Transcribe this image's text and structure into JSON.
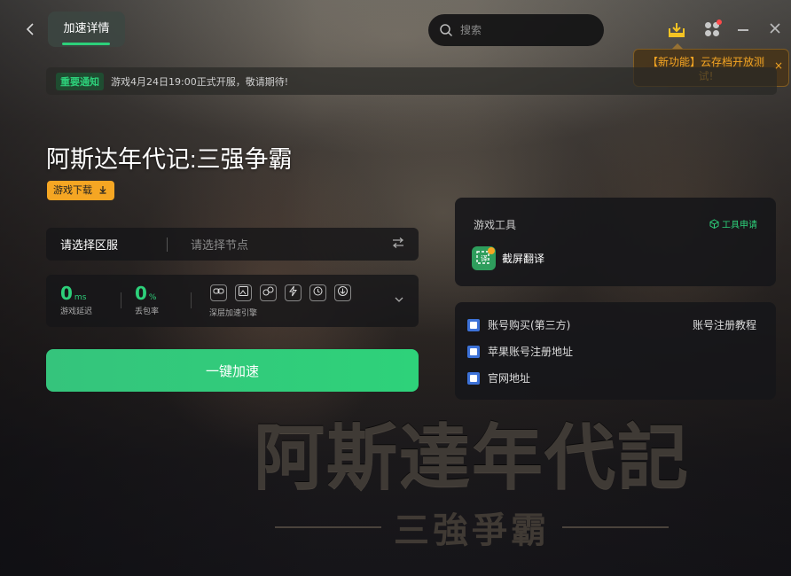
{
  "header": {
    "tab_label": "加速详情",
    "search_placeholder": "搜索"
  },
  "tooltip": {
    "text": "【新功能】云存档开放测试!",
    "close": "×"
  },
  "notice": {
    "badge": "重要通知",
    "text": "游戏4月24日19:00正式开服，敬请期待!"
  },
  "game": {
    "title": "阿斯达年代记:三强争霸",
    "download_label": "游戏下载",
    "logo_text": "阿斯達年代記",
    "logo_subtext": "三強爭霸"
  },
  "server": {
    "region_label": "请选择区服",
    "node_placeholder": "请选择节点"
  },
  "stats": {
    "latency_value": "0",
    "latency_unit": "ms",
    "latency_label": "游戏延迟",
    "loss_value": "0",
    "loss_unit": "%",
    "loss_label": "丢包率",
    "engine_label": "深层加速引擎"
  },
  "boost_button": "一键加速",
  "tools": {
    "title": "游戏工具",
    "apply_label": "工具申请",
    "items": [
      {
        "label": "截屏翻译"
      }
    ]
  },
  "links": {
    "items": [
      {
        "label": "账号购买(第三方)"
      },
      {
        "label": "苹果账号注册地址"
      },
      {
        "label": "官网地址"
      }
    ],
    "tutorial": "账号注册教程"
  },
  "colors": {
    "accent_green": "#2dd07a",
    "warning_orange": "#f5a623",
    "link_blue": "#3d72d8"
  }
}
